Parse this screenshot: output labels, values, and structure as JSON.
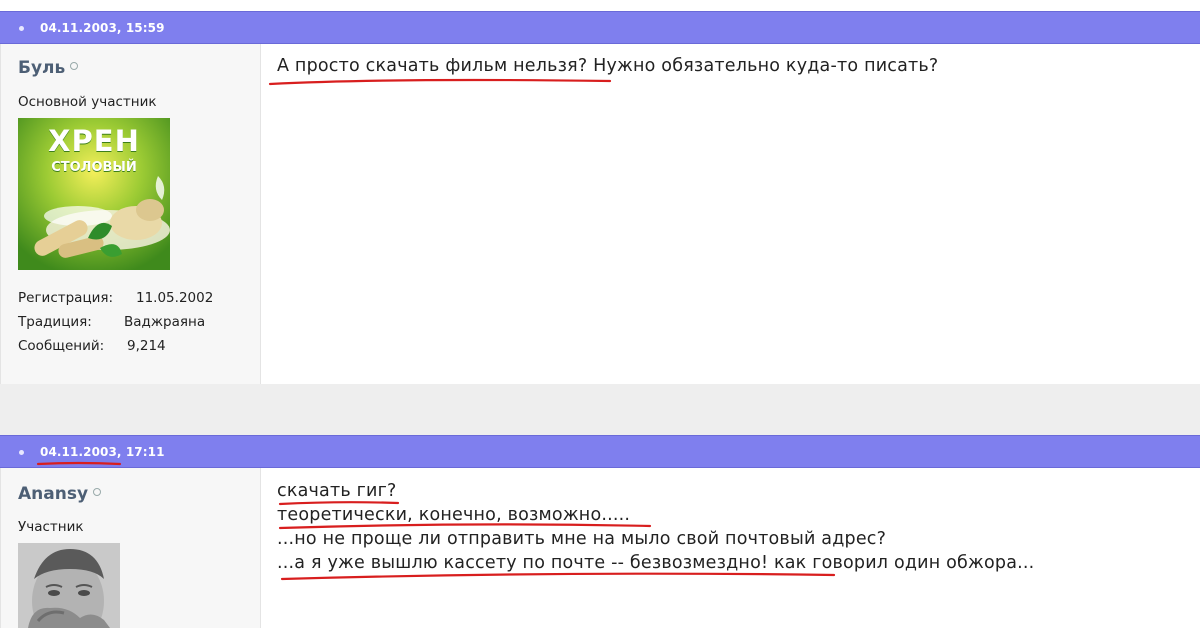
{
  "posts": [
    {
      "date": "04.11.2003, 15:59",
      "author": "Буль",
      "rank": "Основной участник",
      "avatar": {
        "title": "ХРЕН",
        "subtitle": "СТОЛОВЫЙ",
        "colors": {
          "bg": "#6fb12a",
          "accent": "#f2e640",
          "text": "#ffffff"
        }
      },
      "stats": [
        {
          "label": "Регистрация:",
          "value": "11.05.2002"
        },
        {
          "label": "Традиция:",
          "value": "Ваджраяна"
        },
        {
          "label": "Сообщений:",
          "value": "9,214"
        }
      ],
      "lines": [
        "А просто скачать фильм нельзя? Нужно обязательно куда-то писать?"
      ]
    },
    {
      "date": "04.11.2003, 17:11",
      "author": "Anansy",
      "rank": "Участник",
      "lines": [
        "скачать гиг?",
        "теоретически, конечно, возможно.....",
        "...но не проще ли отправить мне на мыло свой почтовый адрес?",
        "...а я уже вышлю кассету по почте -- безвозмездно! как говорил один обжора..."
      ]
    }
  ],
  "colors": {
    "header": "#7f7fee",
    "username": "#4d5f75",
    "underline": "#d81e1e"
  }
}
